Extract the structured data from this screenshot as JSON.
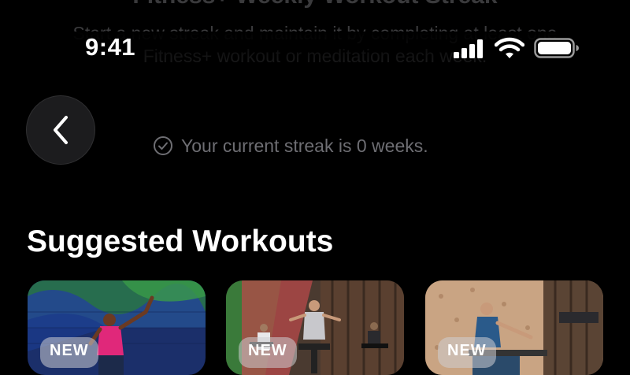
{
  "streak_card": {
    "title": "Fitness+ Weekly Workout Streak",
    "description": "Start a new streak and maintain it by completing at least one Fitness+ workout or meditation each week.",
    "current_streak": "Your current streak is 0 weeks."
  },
  "status_bar": {
    "time": "9:41",
    "icons": [
      "cellular-signal-icon",
      "wifi-icon",
      "battery-icon"
    ]
  },
  "nav": {
    "back_icon": "chevron-left-icon"
  },
  "suggested": {
    "title": "Suggested Workouts",
    "cards": [
      {
        "badge": "NEW",
        "theme": "dance"
      },
      {
        "badge": "NEW",
        "theme": "cycling"
      },
      {
        "badge": "NEW",
        "theme": "rowing"
      }
    ]
  },
  "colors": {
    "background": "#000000",
    "muted_text": "#6e6e73",
    "badge_bg": "#cdcdd2"
  }
}
